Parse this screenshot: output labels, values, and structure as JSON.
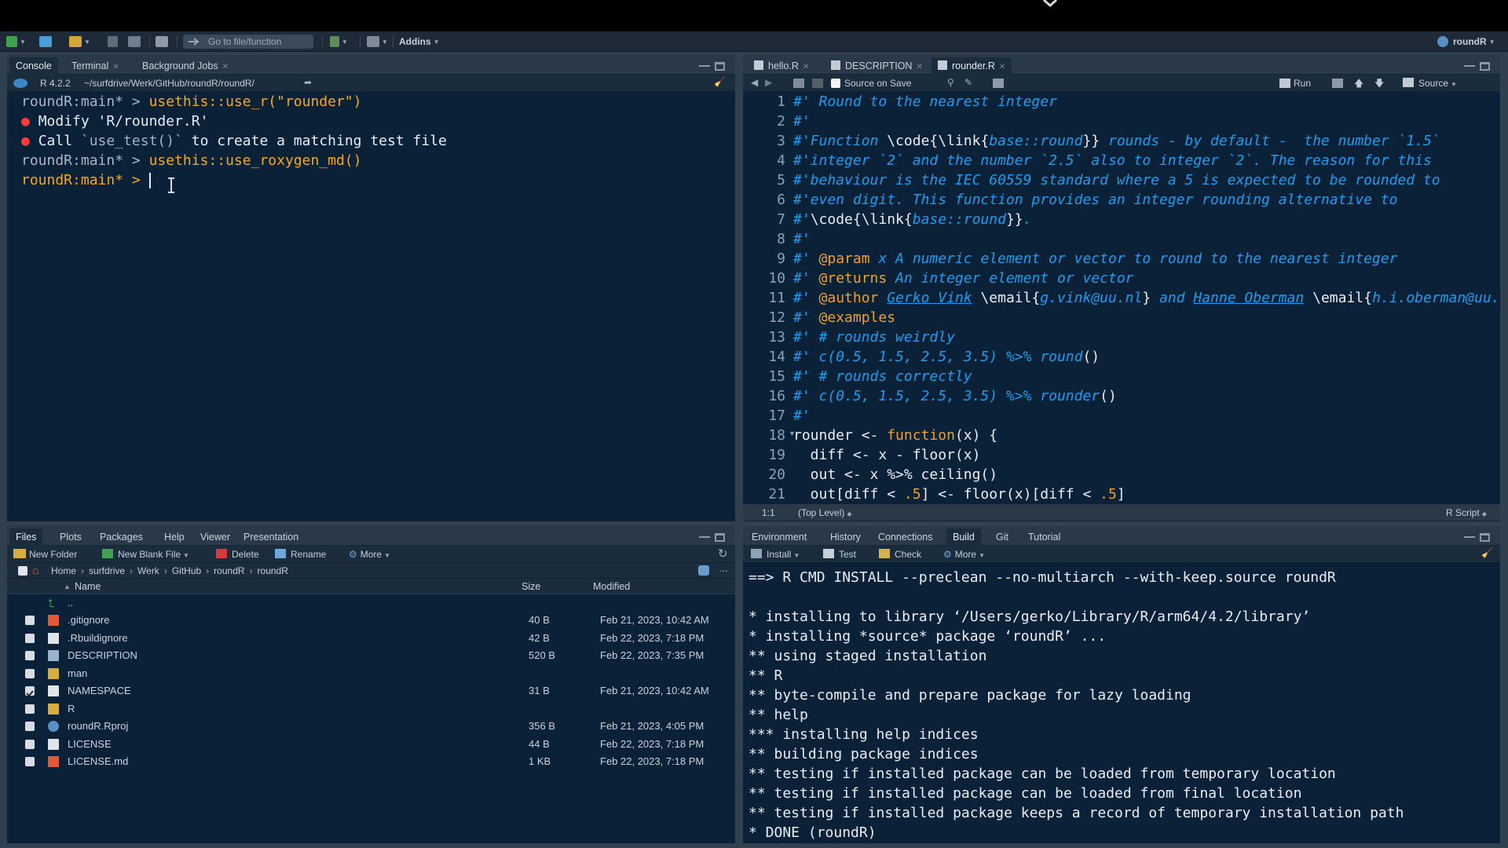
{
  "toolbar": {
    "goto_placeholder": "Go to file/function",
    "addins_label": "Addins",
    "project_label": "roundR"
  },
  "console_pane": {
    "tabs": [
      "Console",
      "Terminal",
      "Background Jobs"
    ],
    "r_version": "R 4.2.2",
    "path": "~/surfdrive/Werk/GitHub/roundR/roundR/",
    "lines": [
      {
        "prompt": "roundR:main* > ",
        "text": "usethis::use_r(\"rounder\")"
      },
      {
        "bullet": "●",
        "text": "Modify 'R/rounder.R'"
      },
      {
        "bullet": "●",
        "text": "Call ",
        "code": "`use_test()`",
        "rest": " to create a matching test file"
      },
      {
        "prompt": "roundR:main* > ",
        "text": "usethis::use_roxygen_md()"
      },
      {
        "prompt": "roundR:main* > ",
        "text": ""
      }
    ]
  },
  "editor_pane": {
    "tabs": [
      "hello.R",
      "DESCRIPTION",
      "rounder.R"
    ],
    "source_on_save": "Source on Save",
    "run_label": "Run",
    "source_label": "Source",
    "status_position": "1:1",
    "status_scope": "(Top Level)",
    "status_type": "R Script",
    "line_numbers": [
      "1",
      "2",
      "3",
      "4",
      "5",
      "6",
      "7",
      "8",
      "9",
      "10",
      "11",
      "12",
      "13",
      "14",
      "15",
      "16",
      "17",
      "18",
      "19",
      "20",
      "21"
    ],
    "code": {
      "l1": "#' Round to the nearest integer",
      "l2": "#'",
      "l3a": "#'Function ",
      "l3b": "\\code{\\link{",
      "l3c": "base::round",
      "l3d": "}}",
      "l3e": " rounds - by default -  the number `1.5`",
      "l4": "#'integer `2` and the number `2.5` also to integer `2`. The reason for this",
      "l5": "#'behaviour is the IEC 60559 standard where a 5 is expected to be rounded to",
      "l6": "#'even digit. This function provides an integer rounding alternative to",
      "l7a": "#'",
      "l7b": "\\code{\\link{",
      "l7c": "base::round",
      "l7d": "}}",
      "l7e": ".",
      "l8": "#'",
      "l9a": "#' ",
      "l9b": "@param",
      "l9c": " x A numeric element or vector to round to the nearest integer",
      "l10a": "#' ",
      "l10b": "@returns",
      "l10c": " An integer element or vector",
      "l11a": "#' ",
      "l11b": "@author",
      "l11c": " ",
      "l11d": "Gerko Vink",
      "l11e": " \\email{",
      "l11f": "g.vink@uu.nl",
      "l11g": "}",
      "l11h": " and ",
      "l11i": "Hanne Oberman",
      "l11j": " \\email{",
      "l11k": "h.i.oberman@uu.nl}",
      "l12a": "#' ",
      "l12b": "@examples",
      "l13": "#' # rounds weirdly",
      "l14a": "#' c(0.5, 1.5, 2.5, 3.5) %>% round",
      "l14b": "()",
      "l15": "#' # rounds correctly",
      "l16a": "#' c(0.5, 1.5, 2.5, 3.5) %>% rounder",
      "l16b": "()",
      "l17": "#'",
      "l18a": "rounder <- ",
      "l18b": "function",
      "l18c": "(x) {",
      "l19": "  diff <- x - floor(x)",
      "l20": "  out <- x %>% ceiling()",
      "l21a": "  out[diff < ",
      "l21b": ".5",
      "l21c": "] <- floor(x)[diff < ",
      "l21d": ".5",
      "l21e": "]"
    }
  },
  "files_pane": {
    "tabs": [
      "Files",
      "Plots",
      "Packages",
      "Help",
      "Viewer",
      "Presentation"
    ],
    "actions": {
      "new_folder": "New Folder",
      "new_blank_file": "New Blank File",
      "delete": "Delete",
      "rename": "Rename",
      "more": "More"
    },
    "breadcrumb": [
      "Home",
      "surfdrive",
      "Werk",
      "GitHub",
      "roundR",
      "roundR"
    ],
    "columns": {
      "name": "Name",
      "size": "Size",
      "modified": "Modified"
    },
    "up_label": "..",
    "rows": [
      {
        "name": ".gitignore",
        "size": "40 B",
        "modified": "Feb 21, 2023, 10:42 AM",
        "icon": "gitignore-icon",
        "checked": false
      },
      {
        "name": ".Rbuildignore",
        "size": "42 B",
        "modified": "Feb 22, 2023, 7:18 PM",
        "icon": "file-icon",
        "checked": false
      },
      {
        "name": "DESCRIPTION",
        "size": "520 B",
        "modified": "Feb 22, 2023, 7:35 PM",
        "icon": "description-icon",
        "checked": false
      },
      {
        "name": "man",
        "size": "",
        "modified": "",
        "icon": "folder-icon",
        "checked": false
      },
      {
        "name": "NAMESPACE",
        "size": "31 B",
        "modified": "Feb 21, 2023, 10:42 AM",
        "icon": "file-icon",
        "checked": true
      },
      {
        "name": "R",
        "size": "",
        "modified": "",
        "icon": "folder-icon",
        "checked": false
      },
      {
        "name": "roundR.Rproj",
        "size": "356 B",
        "modified": "Feb 21, 2023, 4:05 PM",
        "icon": "rproj-icon",
        "checked": false
      },
      {
        "name": "LICENSE",
        "size": "44 B",
        "modified": "Feb 22, 2023, 7:18 PM",
        "icon": "file-icon",
        "checked": false
      },
      {
        "name": "LICENSE.md",
        "size": "1 KB",
        "modified": "Feb 22, 2023, 7:18 PM",
        "icon": "markdown-icon",
        "checked": false
      }
    ]
  },
  "build_pane": {
    "tabs": [
      "Environment",
      "History",
      "Connections",
      "Build",
      "Git",
      "Tutorial"
    ],
    "actions": {
      "install": "Install",
      "test": "Test",
      "check": "Check",
      "more": "More"
    },
    "lines": [
      "==> R CMD INSTALL --preclean --no-multiarch --with-keep.source roundR",
      "",
      "* installing to library ‘/Users/gerko/Library/R/arm64/4.2/library’",
      "* installing *source* package ‘roundR’ ...",
      "** using staged installation",
      "** R",
      "** byte-compile and prepare package for lazy loading",
      "** help",
      "*** installing help indices",
      "** building package indices",
      "** testing if installed package can be loaded from temporary location",
      "** testing if installed package can be loaded from final location",
      "** testing if installed package keeps a record of temporary installation path",
      "* DONE (roundR)"
    ]
  }
}
